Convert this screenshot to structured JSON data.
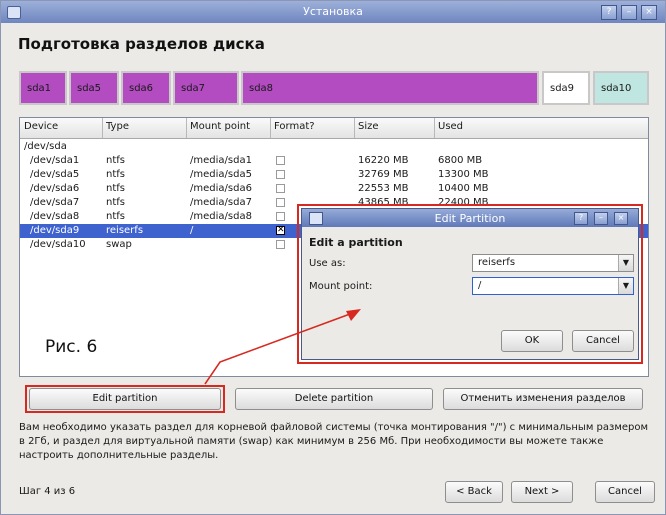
{
  "window": {
    "title": "Установка"
  },
  "heading": "Подготовка разделов диска",
  "partition_bar": [
    {
      "label": "sda1",
      "color": "#b24cc0"
    },
    {
      "label": "sda5",
      "color": "#b24cc0"
    },
    {
      "label": "sda6",
      "color": "#b24cc0"
    },
    {
      "label": "sda7",
      "color": "#b24cc0"
    },
    {
      "label": "sda8",
      "color": "#b24cc0"
    },
    {
      "label": "sda9",
      "color": "#ffffff"
    },
    {
      "label": "sda10",
      "color": "#bfe6e0"
    }
  ],
  "table": {
    "headers": [
      "Device",
      "Type",
      "Mount point",
      "Format?",
      "Size",
      "Used"
    ],
    "rows": [
      {
        "device": "/dev/sda",
        "type": "",
        "mount": "",
        "format": null,
        "size": "",
        "used": ""
      },
      {
        "device": "/dev/sda1",
        "type": "ntfs",
        "mount": "/media/sda1",
        "format": false,
        "size": "16220 MB",
        "used": "6800 MB"
      },
      {
        "device": "/dev/sda5",
        "type": "ntfs",
        "mount": "/media/sda5",
        "format": false,
        "size": "32769 MB",
        "used": "13300 MB"
      },
      {
        "device": "/dev/sda6",
        "type": "ntfs",
        "mount": "/media/sda6",
        "format": false,
        "size": "22553 MB",
        "used": "10400 MB"
      },
      {
        "device": "/dev/sda7",
        "type": "ntfs",
        "mount": "/media/sda7",
        "format": false,
        "size": "43865 MB",
        "used": "22400 MB"
      },
      {
        "device": "/dev/sda8",
        "type": "ntfs",
        "mount": "/media/sda8",
        "format": false,
        "size": "",
        "used": ""
      },
      {
        "device": "/dev/sda9",
        "type": "reiserfs",
        "mount": "/",
        "format": true,
        "size": "",
        "used": "",
        "selected": true
      },
      {
        "device": "/dev/sda10",
        "type": "swap",
        "mount": "",
        "format": false,
        "size": "",
        "used": ""
      }
    ]
  },
  "dialog": {
    "title": "Edit Partition",
    "title_buttons": [
      "?",
      "–",
      "×"
    ],
    "heading": "Edit a partition",
    "use_as_label": "Use as:",
    "use_as_value": "reiserfs",
    "mount_label": "Mount point:",
    "mount_value": "/",
    "ok": "OK",
    "cancel": "Cancel"
  },
  "caption": "Рис. 6",
  "buttons": {
    "edit": "Edit partition",
    "delete": "Delete partition",
    "revert": "Отменить изменения разделов"
  },
  "description": "Вам необходимо указать раздел для корневой файловой системы (точка монтирования \"/\") с минимальным размером в 2Гб, и раздел для виртуальной памяти (swap) как минимум в 256 Мб. При необходимости вы можете также настроить дополнительные разделы.",
  "step": "Шаг 4 из 6",
  "nav": {
    "back": "< Back",
    "next": "Next >",
    "cancel": "Cancel"
  },
  "colors": {
    "accent": "#3e63ce",
    "highlight": "#d62a20"
  }
}
